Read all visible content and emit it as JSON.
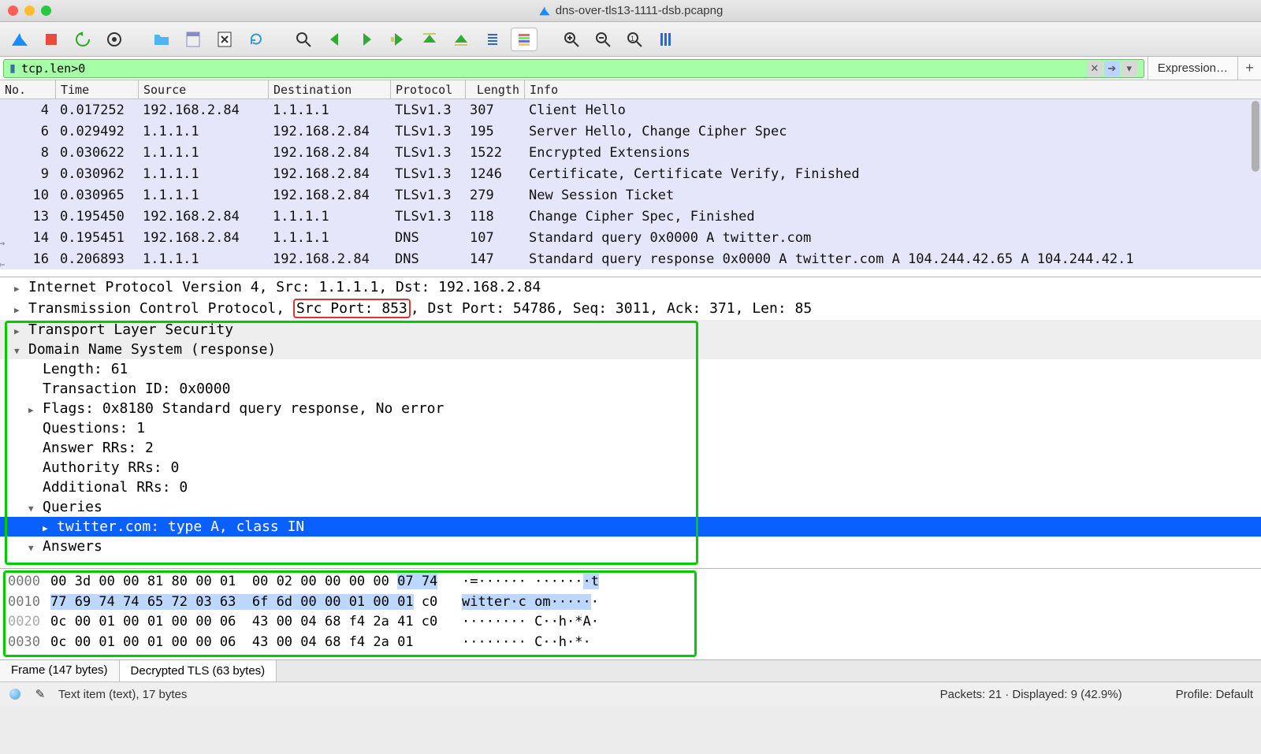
{
  "window": {
    "title": "dns-over-tls13-1111-dsb.pcapng"
  },
  "filter": {
    "value": "tcp.len>0",
    "expression_label": "Expression…"
  },
  "columns": {
    "no": "No.",
    "time": "Time",
    "src": "Source",
    "dst": "Destination",
    "proto": "Protocol",
    "len": "Length",
    "info": "Info"
  },
  "packets": [
    {
      "no": "4",
      "time": "0.017252",
      "src": "192.168.2.84",
      "dst": "1.1.1.1",
      "proto": "TLSv1.3",
      "len": "307",
      "info": "Client Hello",
      "pale": true
    },
    {
      "no": "6",
      "time": "0.029492",
      "src": "1.1.1.1",
      "dst": "192.168.2.84",
      "proto": "TLSv1.3",
      "len": "195",
      "info": "Server Hello, Change Cipher Spec",
      "pale": true
    },
    {
      "no": "8",
      "time": "0.030622",
      "src": "1.1.1.1",
      "dst": "192.168.2.84",
      "proto": "TLSv1.3",
      "len": "1522",
      "info": "Encrypted Extensions",
      "pale": true
    },
    {
      "no": "9",
      "time": "0.030962",
      "src": "1.1.1.1",
      "dst": "192.168.2.84",
      "proto": "TLSv1.3",
      "len": "1246",
      "info": "Certificate, Certificate Verify, Finished",
      "pale": true
    },
    {
      "no": "10",
      "time": "0.030965",
      "src": "1.1.1.1",
      "dst": "192.168.2.84",
      "proto": "TLSv1.3",
      "len": "279",
      "info": "New Session Ticket",
      "pale": true
    },
    {
      "no": "13",
      "time": "0.195450",
      "src": "192.168.2.84",
      "dst": "1.1.1.1",
      "proto": "TLSv1.3",
      "len": "118",
      "info": "Change Cipher Spec, Finished",
      "pale": true
    },
    {
      "no": "14",
      "time": "0.195451",
      "src": "192.168.2.84",
      "dst": "1.1.1.1",
      "proto": "DNS",
      "len": "107",
      "info": "Standard query 0x0000 A twitter.com",
      "pale": true
    },
    {
      "no": "16",
      "time": "0.206893",
      "src": "1.1.1.1",
      "dst": "192.168.2.84",
      "proto": "DNS",
      "len": "147",
      "info": "Standard query response 0x0000 A twitter.com A 104.244.42.65 A 104.244.42.1",
      "pale": true
    }
  ],
  "details": {
    "ip": "Internet Protocol Version 4, Src: 1.1.1.1, Dst: 192.168.2.84",
    "tcp_pre": "Transmission Control Protocol, ",
    "tcp_src": "Src Port: 853",
    "tcp_post": ", Dst Port: 54786, Seq: 3011, Ack: 371, Len: 85",
    "tls": "Transport Layer Security",
    "dns": "Domain Name System (response)",
    "length": "Length: 61",
    "txid": "Transaction ID: 0x0000",
    "flags": "Flags: 0x8180 Standard query response, No error",
    "questions": "Questions: 1",
    "answer_rrs": "Answer RRs: 2",
    "auth_rrs": "Authority RRs: 0",
    "add_rrs": "Additional RRs: 0",
    "queries": "Queries",
    "query_item": "twitter.com: type A, class IN",
    "answers": "Answers"
  },
  "hex": {
    "rows": [
      {
        "off": "0000",
        "b1": "00 3d 00 00 81 80 00 01  00 02 00 00 00 00 ",
        "b1h": "07 74",
        "b1t": "   ",
        "a1": "·=······ ······",
        "a1h": "·t"
      },
      {
        "off": "0010",
        "b1": "",
        "b1h": "77 69 74 74 65 72 03 63  6f 6d 00 00 01 00 01",
        "b1t": " c0   ",
        "a1": "",
        "a1h": "witter·c om·····",
        "a1t": "·"
      },
      {
        "off": "0020",
        "b1": "0c 00 01 00 01 00 00 06  43 00 04 68 f4 2a 41 c0   ",
        "a1": "········ C··h·*A·",
        "dim": true
      },
      {
        "off": "0030",
        "b1": "0c 00 01 00 01 00 00 06  43 00 04 68 f4 2a 01      ",
        "a1": "········ C··h·*· "
      }
    ]
  },
  "tabs": {
    "frame": "Frame (147 bytes)",
    "decrypted": "Decrypted TLS (63 bytes)"
  },
  "status": {
    "item": "Text item (text), 17 bytes",
    "packets": "Packets: 21 · Displayed: 9 (42.9%)",
    "profile": "Profile: Default"
  }
}
